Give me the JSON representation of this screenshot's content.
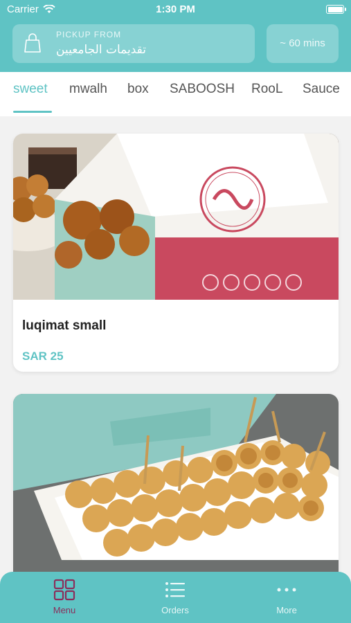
{
  "status_bar": {
    "carrier": "Carrier",
    "time": "1:30 PM"
  },
  "header": {
    "pickup_label": "PICKUP FROM",
    "pickup_name": "تقديمات الجامعيين",
    "eta": "~ 60 mins"
  },
  "tabs": [
    {
      "label": "sweet",
      "active": true
    },
    {
      "label": "mwalh"
    },
    {
      "label": "box"
    },
    {
      "label": "SABOOSH"
    },
    {
      "label": "RooL"
    },
    {
      "label": "Sauce"
    }
  ],
  "products": [
    {
      "title": "luqimat small",
      "price": "SAR 25"
    }
  ],
  "bottom_nav": [
    {
      "label": "Menu",
      "icon": "grid-icon",
      "active": true
    },
    {
      "label": "Orders",
      "icon": "list-icon"
    },
    {
      "label": "More",
      "icon": "more-dots-icon"
    }
  ],
  "colors": {
    "accent": "#5fc3c4",
    "active_nav": "#8b2d5a"
  }
}
